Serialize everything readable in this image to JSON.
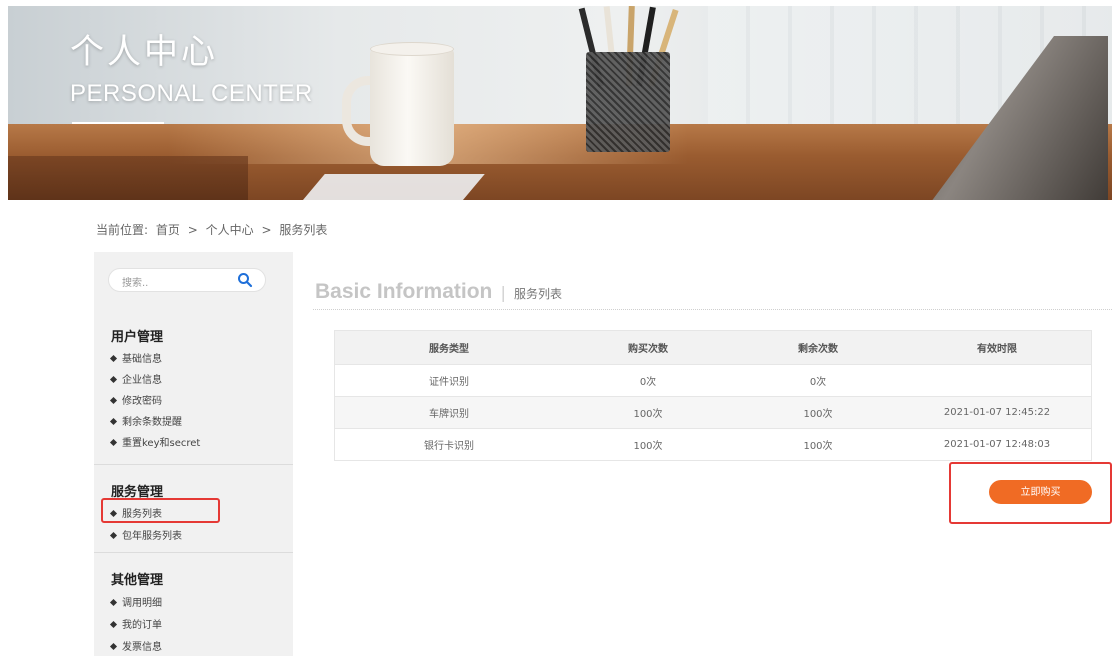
{
  "banner": {
    "title_cn": "个人中心",
    "title_en": "PERSONAL CENTER"
  },
  "breadcrumb": {
    "prefix": "当前位置:",
    "items": [
      "首页",
      "个人中心",
      "服务列表"
    ],
    "separator": ">"
  },
  "sidebar": {
    "search": {
      "placeholder": "搜索..",
      "icon": "search-icon"
    },
    "groups": [
      {
        "title": "用户管理",
        "items": [
          "基础信息",
          "企业信息",
          "修改密码",
          "剩余条数提醒",
          "重置key和secret"
        ]
      },
      {
        "title": "服务管理",
        "items": [
          "服务列表",
          "包年服务列表"
        ]
      },
      {
        "title": "其他管理",
        "items": [
          "调用明细",
          "我的订单",
          "发票信息"
        ]
      }
    ]
  },
  "main": {
    "title_en": "Basic Information",
    "title_sep": "|",
    "title_cn": "服务列表",
    "table": {
      "headers": [
        "服务类型",
        "购买次数",
        "剩余次数",
        "有效时限"
      ],
      "rows": [
        [
          "证件识别",
          "0次",
          "0次",
          ""
        ],
        [
          "车牌识别",
          "100次",
          "100次",
          "2021-01-07 12:45:22"
        ],
        [
          "银行卡识别",
          "100次",
          "100次",
          "2021-01-07 12:48:03"
        ]
      ]
    },
    "buy_button": "立即购买"
  },
  "colors": {
    "accent": "#f06b24",
    "highlight": "#e53935",
    "sidebar_bg": "#f1f1f1"
  }
}
